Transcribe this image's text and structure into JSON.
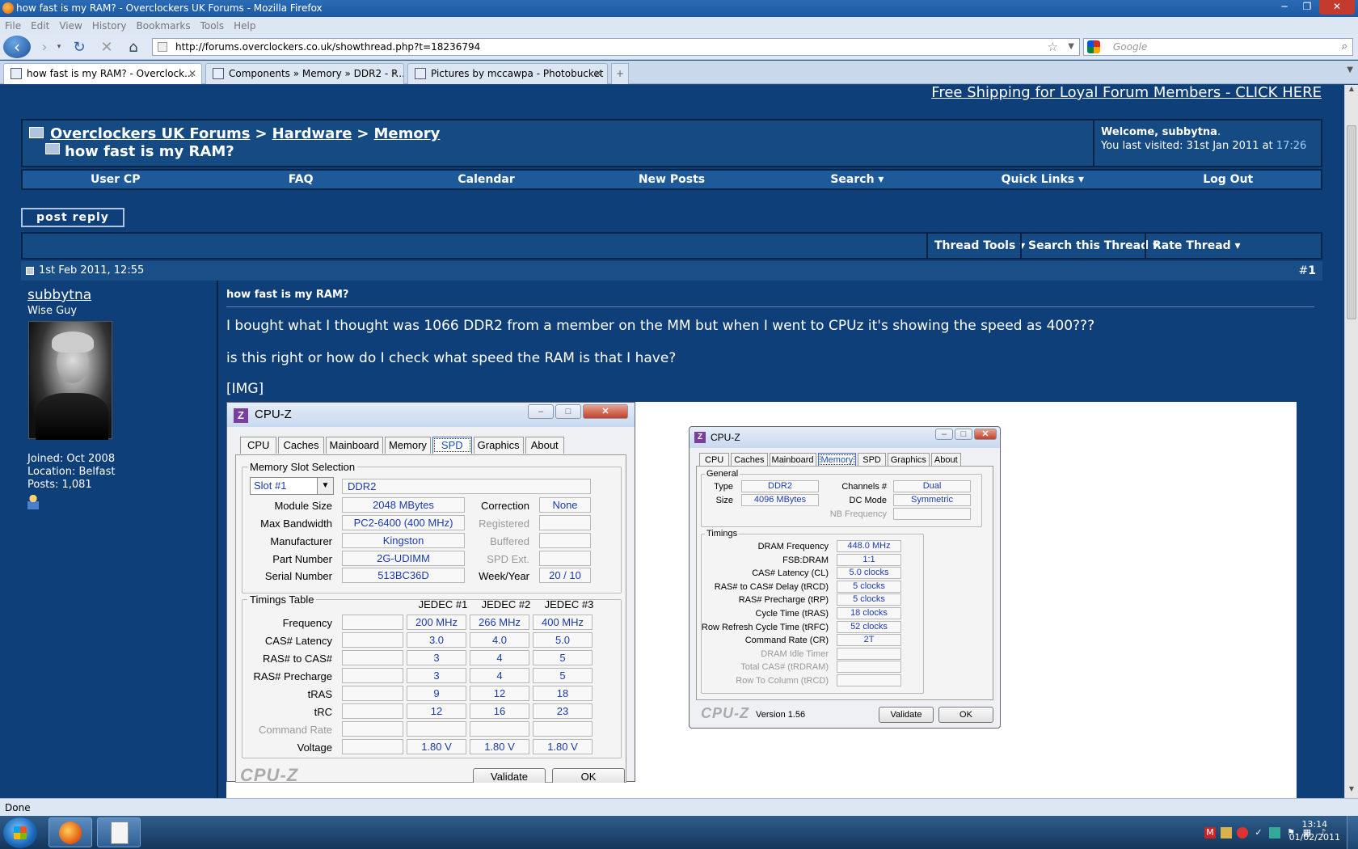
{
  "browser": {
    "window_title": "how fast is my RAM? - Overclockers UK Forums - Mozilla Firefox",
    "menu": [
      "File",
      "Edit",
      "View",
      "History",
      "Bookmarks",
      "Tools",
      "Help"
    ],
    "url": "http://forums.overclockers.co.uk/showthread.php?t=18236794",
    "search_placeholder": "Google",
    "tabs": [
      {
        "label": "how fast is my RAM? - Overclock...",
        "active": true
      },
      {
        "label": "Components » Memory » DDR2 - P...",
        "active": false
      },
      {
        "label": "Pictures by mccawpa - Photobucket",
        "active": false
      }
    ],
    "status": "Done"
  },
  "forum": {
    "promo": "Free Shipping for Loyal Forum Members - CLICK HERE",
    "breadcrumb": [
      "Overclockers UK Forums",
      "Hardware",
      "Memory"
    ],
    "thread_title": "how fast is my RAM?",
    "welcome_prefix": "Welcome, ",
    "welcome_user": "subbytna",
    "last_visited_prefix": "You last visited: 31st Jan 2011 at ",
    "last_visited_time": "17:26",
    "nav": [
      "User CP",
      "FAQ",
      "Calendar",
      "New Posts",
      "Search ▾",
      "Quick Links ▾",
      "Log Out"
    ],
    "post_reply": "post reply",
    "thread_tools": [
      "Thread Tools ▾",
      "Search this Thread ▾",
      "Rate Thread ▾"
    ],
    "post": {
      "date": "1st Feb 2011, 12:55",
      "number_prefix": "#",
      "number": "1",
      "user": "subbytna",
      "user_title": "Wise Guy",
      "joined": "Joined: Oct 2008",
      "location": "Location: Belfast",
      "posts": "Posts: 1,081",
      "title": "how fast is my RAM?",
      "line1": "I bought what I thought was 1066 DDR2 from a member on the MM but when I went to CPUz it's showing the speed as 400???",
      "line2": "is this right or how do I check what speed the RAM is that I have?",
      "img_tag": "[IMG]"
    }
  },
  "cpuz_spd": {
    "title": "CPU-Z",
    "tabs": [
      "CPU",
      "Caches",
      "Mainboard",
      "Memory",
      "SPD",
      "Graphics",
      "About"
    ],
    "active_tab": "SPD",
    "slot_group": "Memory Slot Selection",
    "slot": "Slot #1",
    "mem_type": "DDR2",
    "module_size_label": "Module Size",
    "module_size": "2048 MBytes",
    "correction_label": "Correction",
    "correction": "None",
    "max_bw_label": "Max Bandwidth",
    "max_bw": "PC2-6400 (400 MHz)",
    "registered_label": "Registered",
    "manufacturer_label": "Manufacturer",
    "manufacturer": "Kingston",
    "buffered_label": "Buffered",
    "part_label": "Part Number",
    "part": "2G-UDIMM",
    "spd_ext_label": "SPD Ext.",
    "serial_label": "Serial Number",
    "serial": "513BC36D",
    "week_label": "Week/Year",
    "week": "20 / 10",
    "timings_group": "Timings Table",
    "jedec_headers": [
      "JEDEC #1",
      "JEDEC #2",
      "JEDEC #3"
    ],
    "rows": [
      {
        "label": "Frequency",
        "vals": [
          "200 MHz",
          "266 MHz",
          "400 MHz"
        ]
      },
      {
        "label": "CAS# Latency",
        "vals": [
          "3.0",
          "4.0",
          "5.0"
        ]
      },
      {
        "label": "RAS# to CAS#",
        "vals": [
          "3",
          "4",
          "5"
        ]
      },
      {
        "label": "RAS# Precharge",
        "vals": [
          "3",
          "4",
          "5"
        ]
      },
      {
        "label": "tRAS",
        "vals": [
          "9",
          "12",
          "18"
        ]
      },
      {
        "label": "tRC",
        "vals": [
          "12",
          "16",
          "23"
        ]
      },
      {
        "label": "Command Rate",
        "vals": [
          "",
          "",
          ""
        ]
      },
      {
        "label": "Voltage",
        "vals": [
          "1.80 V",
          "1.80 V",
          "1.80 V"
        ]
      }
    ]
  },
  "cpuz_mem": {
    "title": "CPU-Z",
    "tabs": [
      "CPU",
      "Caches",
      "Mainboard",
      "Memory",
      "SPD",
      "Graphics",
      "About"
    ],
    "active_tab": "Memory",
    "general_group": "General",
    "type_label": "Type",
    "type": "DDR2",
    "size_label": "Size",
    "size": "4096 MBytes",
    "channels_label": "Channels #",
    "channels": "Dual",
    "dcmode_label": "DC Mode",
    "dcmode": "Symmetric",
    "nbfreq_label": "NB Frequency",
    "timings_group": "Timings",
    "timings": [
      {
        "label": "DRAM Frequency",
        "val": "448.0 MHz"
      },
      {
        "label": "FSB:DRAM",
        "val": "1:1"
      },
      {
        "label": "CAS# Latency (CL)",
        "val": "5.0 clocks"
      },
      {
        "label": "RAS# to CAS# Delay (tRCD)",
        "val": "5 clocks"
      },
      {
        "label": "RAS# Precharge (tRP)",
        "val": "5 clocks"
      },
      {
        "label": "Cycle Time (tRAS)",
        "val": "18 clocks"
      },
      {
        "label": "Row Refresh Cycle Time (tRFC)",
        "val": "52 clocks"
      },
      {
        "label": "Command Rate (CR)",
        "val": "2T"
      },
      {
        "label": "DRAM Idle Timer",
        "val": ""
      },
      {
        "label": "Total CAS# (tRDRAM)",
        "val": ""
      },
      {
        "label": "Row To Column (tRCD)",
        "val": ""
      }
    ],
    "logo": "CPU-Z",
    "version": "Version 1.56",
    "validate": "Validate",
    "ok": "OK"
  },
  "taskbar": {
    "time": "13:14",
    "date": "01/02/2011"
  },
  "colors": {
    "forum_bg": "#0e3f78",
    "nav_bg": "#1e5a9a",
    "cpuz_value": "#1a3bb0"
  }
}
